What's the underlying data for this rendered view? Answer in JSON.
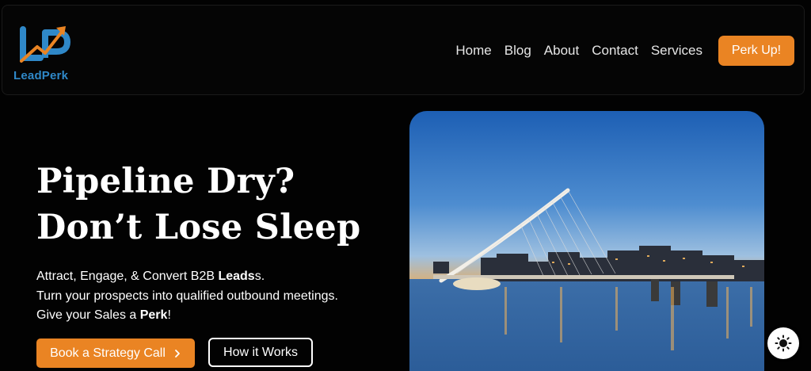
{
  "brand": {
    "name": "LeadPerk",
    "colors": {
      "accent": "#ea8423",
      "logo_blue": "#2f88c8"
    }
  },
  "nav": {
    "items": [
      {
        "label": "Home"
      },
      {
        "label": "Blog"
      },
      {
        "label": "About"
      },
      {
        "label": "Contact"
      },
      {
        "label": "Services"
      }
    ],
    "cta_label": "Perk Up!"
  },
  "hero": {
    "headline_line1": "Pipeline Dry?",
    "headline_line2": "Don’t Lose Sleep",
    "line1_pre": "Attract, Engage, & Convert B2B ",
    "line1_bold": "Leads",
    "line1_post": "s.",
    "line2": "Turn your prospects into qualified outbound meetings.",
    "line3_pre": "Give your Sales a ",
    "line3_bold": "Perk",
    "line3_post": "!",
    "primary_button": "Book a Strategy Call",
    "primary_button_icon": "chevron-right-icon",
    "secondary_button": "How it Works"
  },
  "theme_toggle": {
    "icon": "sun-icon"
  }
}
